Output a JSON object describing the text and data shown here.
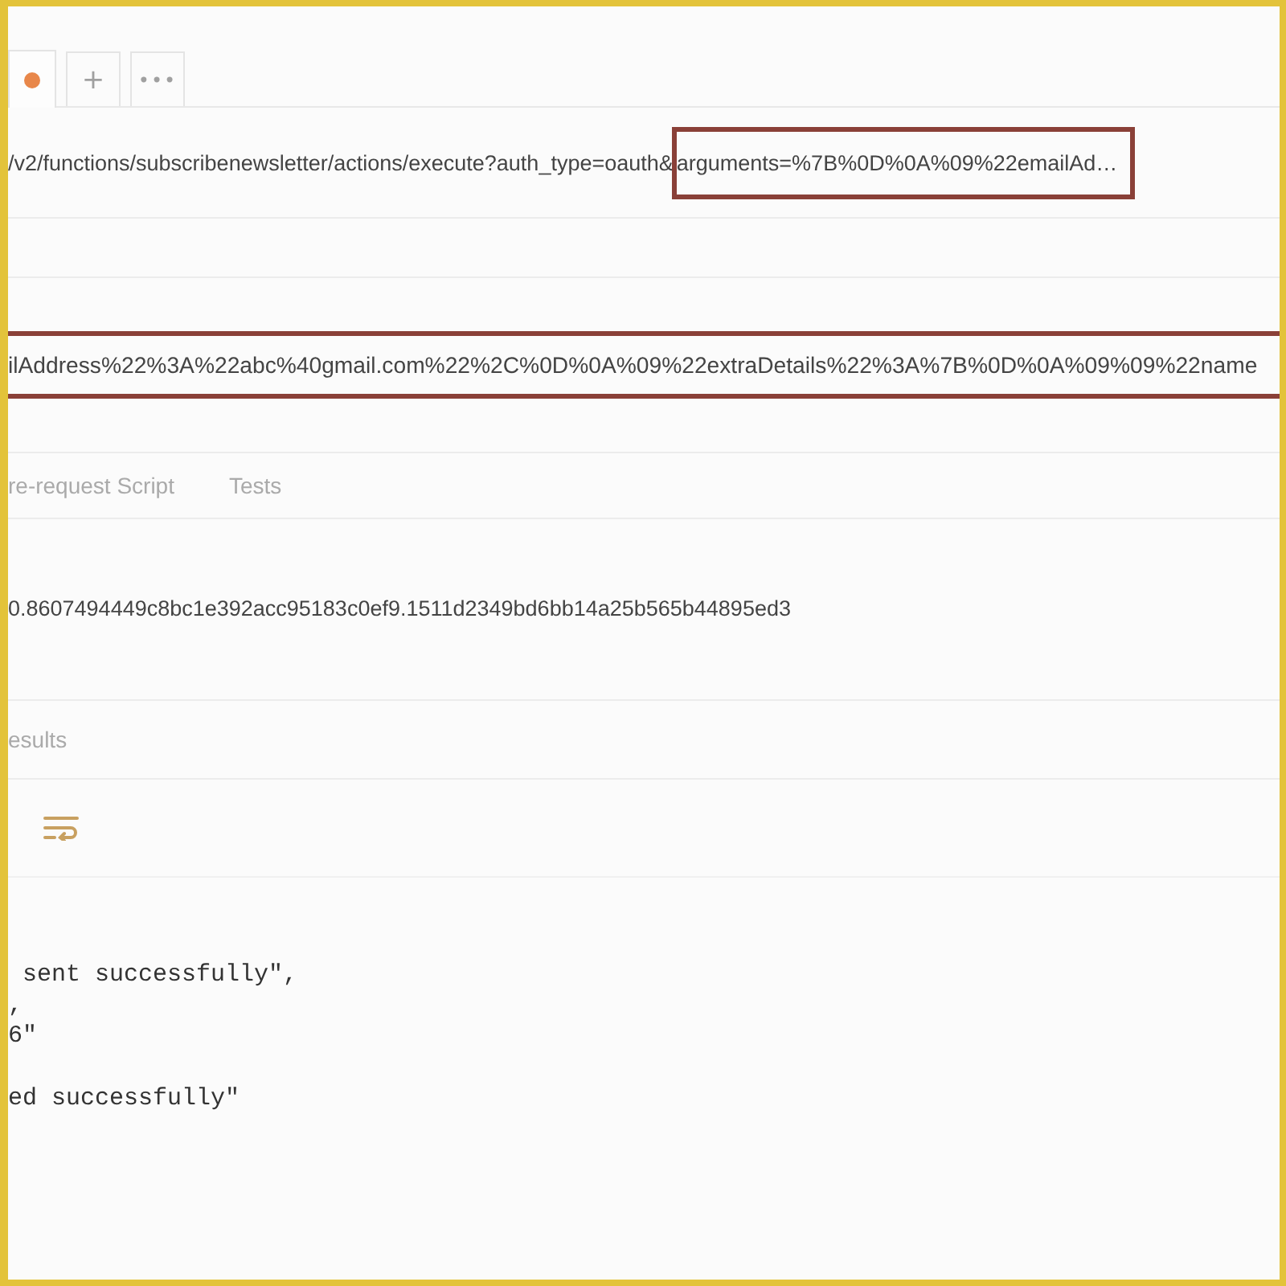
{
  "request_tabs": [
    {
      "kind": "request",
      "unsaved": true,
      "selected": true
    },
    {
      "kind": "new",
      "label": "+",
      "selected": false
    },
    {
      "kind": "more",
      "label": "•••",
      "selected": false
    }
  ],
  "url": {
    "segments": [
      {
        "text": "/v2/functions/subscribenewsletter/actions/execute?auth_type=oauth&",
        "highlighted": false
      },
      {
        "text": "arguments=%7B%0D%0A%09%22emailAd…",
        "highlighted": true
      }
    ]
  },
  "body": {
    "text": "ilAddress%22%3A%22abc%40gmail.com%22%2C%0D%0A%09%22extraDetails%22%3A%7B%0D%0A%09%09%22name",
    "highlighted": true
  },
  "section_tabs": [
    {
      "label": "re-request Script",
      "selected": false
    },
    {
      "label": "Tests",
      "selected": false
    }
  ],
  "token": "0.8607494449c8bc1e392acc95183c0ef9.1511d2349bd6bb14a25b565b44895ed3",
  "response_tabs": [
    {
      "label": "esults",
      "selected": false
    }
  ],
  "response_toolbar": {
    "wrap_lines": true
  },
  "response_lines": [
    " sent successfully\",",
    ",",
    "6\"",
    "ed successfully\""
  ]
}
